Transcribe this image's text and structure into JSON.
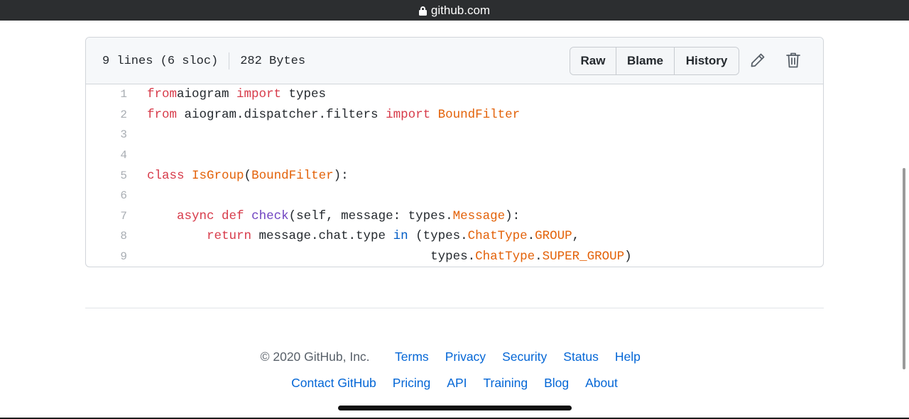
{
  "browser": {
    "url": "github.com",
    "lock_icon": "lock-icon"
  },
  "file_header": {
    "lines_info": "9 lines (6 sloc)",
    "size": "282 Bytes",
    "buttons": {
      "raw": "Raw",
      "blame": "Blame",
      "history": "History"
    },
    "icons": {
      "edit": "pencil-icon",
      "delete": "trash-icon"
    }
  },
  "code": {
    "line_numbers": [
      "1",
      "2",
      "3",
      "4",
      "5",
      "6",
      "7",
      "8",
      "9"
    ],
    "lines": [
      [
        [
          "k",
          "from"
        ],
        [
          "",
          "aiogram "
        ],
        [
          "k",
          "import"
        ],
        [
          "",
          " types"
        ]
      ],
      [
        [
          "k",
          "from"
        ],
        [
          "",
          " aiogram.dispatcher.filters "
        ],
        [
          "k",
          "import"
        ],
        [
          "",
          " "
        ],
        [
          "e",
          "BoundFilter"
        ]
      ],
      [],
      [],
      [
        [
          "k",
          "class"
        ],
        [
          "",
          " "
        ],
        [
          "e",
          "IsGroup"
        ],
        [
          "",
          "("
        ],
        [
          "e",
          "BoundFilter"
        ],
        [
          "",
          "):"
        ]
      ],
      [],
      [
        [
          "",
          "    "
        ],
        [
          "k",
          "async"
        ],
        [
          "",
          " "
        ],
        [
          "k",
          "def"
        ],
        [
          "",
          " "
        ],
        [
          "f",
          "check"
        ],
        [
          "",
          "(self, message: types."
        ],
        [
          "e",
          "Message"
        ],
        [
          "",
          "):"
        ]
      ],
      [
        [
          "",
          "        "
        ],
        [
          "k",
          "return"
        ],
        [
          "",
          " message.chat.type "
        ],
        [
          "b",
          "in"
        ],
        [
          "",
          " (types."
        ],
        [
          "e",
          "ChatType"
        ],
        [
          "",
          "."
        ],
        [
          "e",
          "GROUP"
        ],
        [
          "",
          ","
        ]
      ],
      [
        [
          "",
          "                                      types."
        ],
        [
          "e",
          "ChatType"
        ],
        [
          "",
          "."
        ],
        [
          "e",
          "SUPER_GROUP"
        ],
        [
          "",
          ")"
        ]
      ]
    ]
  },
  "footer": {
    "copyright": "© 2020 GitHub, Inc.",
    "row1_links": [
      "Terms",
      "Privacy",
      "Security",
      "Status",
      "Help"
    ],
    "row2_links": [
      "Contact GitHub",
      "Pricing",
      "API",
      "Training",
      "Blog",
      "About"
    ]
  },
  "colors": {
    "keyword": "#d73a49",
    "entity": "#e36209",
    "function": "#6f42c1",
    "builtin": "#005cc5",
    "link": "#0366d6"
  }
}
